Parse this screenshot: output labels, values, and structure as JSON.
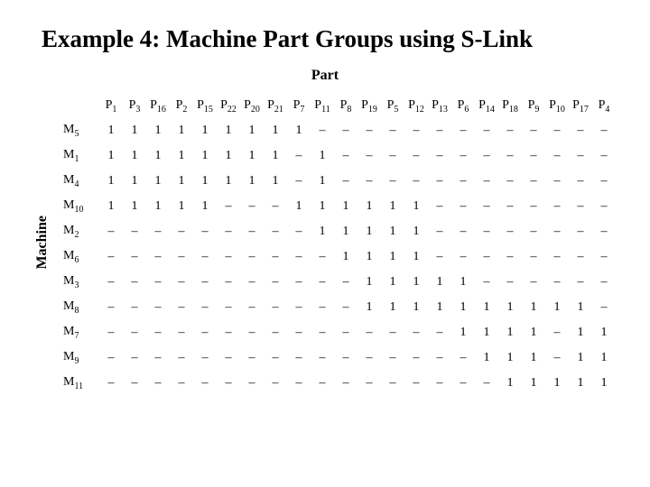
{
  "title": "Example 4: Machine Part Groups using S-Link",
  "header_top": "Part",
  "header_left": "Machine",
  "part_prefix": "P",
  "machine_prefix": "M",
  "blank": "–",
  "chart_data": {
    "type": "table",
    "title": "Example 4: Machine Part Groups using S-Link",
    "xlabel": "Part",
    "ylabel": "Machine",
    "columns": [
      "1",
      "3",
      "16",
      "2",
      "15",
      "22",
      "20",
      "21",
      "7",
      "11",
      "8",
      "19",
      "5",
      "12",
      "13",
      "6",
      "14",
      "18",
      "9",
      "10",
      "17",
      "4"
    ],
    "rows": [
      "5",
      "1",
      "4",
      "10",
      "2",
      "6",
      "3",
      "8",
      "7",
      "9",
      "11"
    ],
    "matrix": [
      [
        1,
        1,
        1,
        1,
        1,
        1,
        1,
        1,
        1,
        0,
        0,
        0,
        0,
        0,
        0,
        0,
        0,
        0,
        0,
        0,
        0,
        0
      ],
      [
        1,
        1,
        1,
        1,
        1,
        1,
        1,
        1,
        0,
        1,
        0,
        0,
        0,
        0,
        0,
        0,
        0,
        0,
        0,
        0,
        0,
        0
      ],
      [
        1,
        1,
        1,
        1,
        1,
        1,
        1,
        1,
        0,
        1,
        0,
        0,
        0,
        0,
        0,
        0,
        0,
        0,
        0,
        0,
        0,
        0
      ],
      [
        1,
        1,
        1,
        1,
        1,
        0,
        0,
        0,
        1,
        1,
        1,
        1,
        1,
        1,
        0,
        0,
        0,
        0,
        0,
        0,
        0,
        0
      ],
      [
        0,
        0,
        0,
        0,
        0,
        0,
        0,
        0,
        0,
        1,
        1,
        1,
        1,
        1,
        0,
        0,
        0,
        0,
        0,
        0,
        0,
        0
      ],
      [
        0,
        0,
        0,
        0,
        0,
        0,
        0,
        0,
        0,
        0,
        1,
        1,
        1,
        1,
        0,
        0,
        0,
        0,
        0,
        0,
        0,
        0
      ],
      [
        0,
        0,
        0,
        0,
        0,
        0,
        0,
        0,
        0,
        0,
        0,
        1,
        1,
        1,
        1,
        1,
        0,
        0,
        0,
        0,
        0,
        0
      ],
      [
        0,
        0,
        0,
        0,
        0,
        0,
        0,
        0,
        0,
        0,
        0,
        1,
        1,
        1,
        1,
        1,
        1,
        1,
        1,
        1,
        1,
        0
      ],
      [
        0,
        0,
        0,
        0,
        0,
        0,
        0,
        0,
        0,
        0,
        0,
        0,
        0,
        0,
        0,
        1,
        1,
        1,
        1,
        0,
        1,
        1
      ],
      [
        0,
        0,
        0,
        0,
        0,
        0,
        0,
        0,
        0,
        0,
        0,
        0,
        0,
        0,
        0,
        0,
        1,
        1,
        1,
        0,
        1,
        1
      ],
      [
        0,
        0,
        0,
        0,
        0,
        0,
        0,
        0,
        0,
        0,
        0,
        0,
        0,
        0,
        0,
        0,
        0,
        1,
        1,
        1,
        1,
        1
      ]
    ]
  }
}
